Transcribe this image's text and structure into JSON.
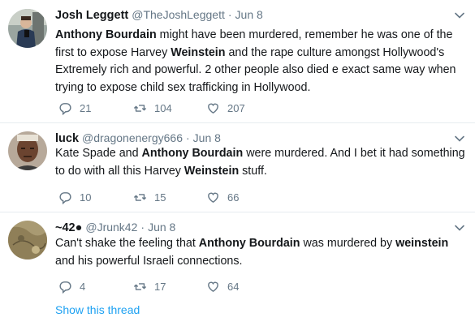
{
  "tweets": [
    {
      "name": "Josh Leggett",
      "handle": "@TheJoshLeggett",
      "separator": "·",
      "time": "Jun 8",
      "avatar_icon": "profile-photo-man-mirror-selfie",
      "body_segments": [
        {
          "text": "Anthony Bourdain",
          "bold": true
        },
        {
          "text": " might have been murdered, remember he was one of the first to expose Harvey ",
          "bold": false
        },
        {
          "text": "Weinstein",
          "bold": true
        },
        {
          "text": " and the rape culture amongst Hollywood's Extremely rich and powerful. 2 other people also died e exact same way when trying to expose child sex trafficking in Hollywood.",
          "bold": false
        }
      ],
      "replies": "21",
      "retweets": "104",
      "likes": "207"
    },
    {
      "name": "luck",
      "handle": "@dragonenergy666",
      "separator": "·",
      "time": "Jun 8",
      "avatar_icon": "profile-photo-man-face",
      "body_segments": [
        {
          "text": "Kate Spade and ",
          "bold": false
        },
        {
          "text": "Anthony Bourdain",
          "bold": true
        },
        {
          "text": " were  murdered. And I bet it had something to do with all this Harvey ",
          "bold": false
        },
        {
          "text": "Weinstein",
          "bold": true
        },
        {
          "text": " stuff.",
          "bold": false
        }
      ],
      "replies": "10",
      "retweets": "15",
      "likes": "66"
    },
    {
      "name": "~42●",
      "handle": "@Jrunk42",
      "separator": "·",
      "time": "Jun 8",
      "avatar_icon": "profile-photo-old-map",
      "body_segments": [
        {
          "text": "Can't shake the feeling that ",
          "bold": false
        },
        {
          "text": "Anthony Bourdain",
          "bold": true
        },
        {
          "text": " was murdered by ",
          "bold": false
        },
        {
          "text": "weinstein",
          "bold": true
        },
        {
          "text": " and his powerful Israeli connections.",
          "bold": false
        }
      ],
      "replies": "4",
      "retweets": "17",
      "likes": "64"
    }
  ],
  "show_thread_label": "Show this thread",
  "colors": {
    "text": "#14171a",
    "secondary": "#657786",
    "link": "#1da1f2",
    "divider": "#e6ecf0"
  },
  "icons": {
    "reply": "reply-icon",
    "retweet": "retweet-icon",
    "like": "heart-icon",
    "menu": "chevron-down-icon"
  }
}
